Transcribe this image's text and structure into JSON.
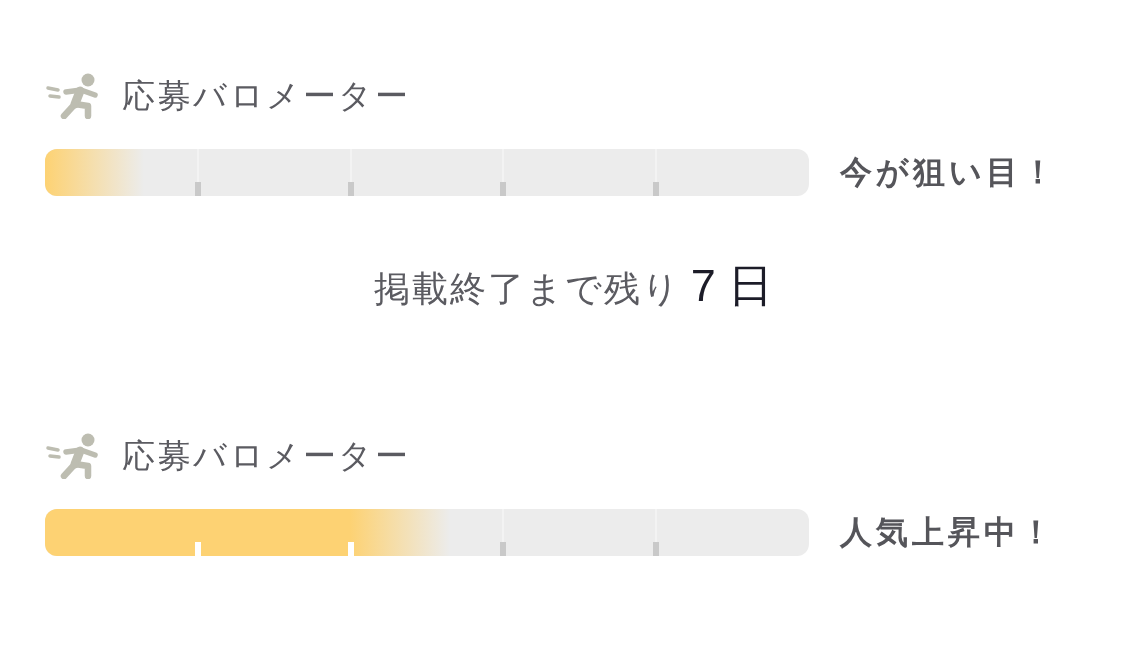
{
  "items": [
    {
      "kind": "meter",
      "title": "応募バロメーター",
      "level": 0.13,
      "status": "今が狙い目！"
    },
    {
      "kind": "deadline",
      "label": "掲載終了まで残り",
      "days": "7 日"
    },
    {
      "kind": "meter",
      "title": "応募バロメーター",
      "level": 0.53,
      "status": "人気上昇中！"
    }
  ]
}
